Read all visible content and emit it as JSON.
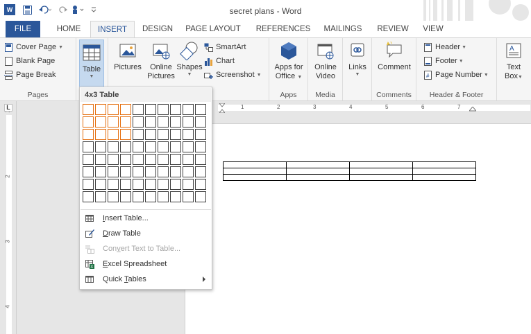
{
  "window": {
    "title": "secret plans - Word"
  },
  "tabs": [
    {
      "label": "FILE"
    },
    {
      "label": "HOME"
    },
    {
      "label": "INSERT"
    },
    {
      "label": "DESIGN"
    },
    {
      "label": "PAGE LAYOUT"
    },
    {
      "label": "REFERENCES"
    },
    {
      "label": "MAILINGS"
    },
    {
      "label": "REVIEW"
    },
    {
      "label": "VIEW"
    }
  ],
  "ribbon": {
    "pages": {
      "label": "Pages",
      "cover": "Cover Page",
      "blank": "Blank Page",
      "break": "Page Break"
    },
    "tables": {
      "table": "Table"
    },
    "illustrations": {
      "pictures": "Pictures",
      "online1": "Online",
      "online2": "Pictures",
      "shapes": "Shapes",
      "smartart": "SmartArt",
      "chart": "Chart",
      "screenshot": "Screenshot"
    },
    "apps": {
      "label": "Apps",
      "apps1": "Apps for",
      "apps2": "Office"
    },
    "media": {
      "label": "Media",
      "video1": "Online",
      "video2": "Video"
    },
    "links": {
      "links": "Links"
    },
    "comments": {
      "label": "Comments",
      "comment": "Comment"
    },
    "header_footer": {
      "label": "Header & Footer",
      "header": "Header",
      "footer": "Footer",
      "pagenum": "Page Number"
    },
    "text": {
      "text1": "Text",
      "text2": "Box"
    }
  },
  "dropdown": {
    "title": "4x3 Table",
    "grid": {
      "cols": 10,
      "rows": 8,
      "sel_cols": 4,
      "sel_rows": 3
    },
    "items": [
      {
        "pre": "",
        "key": "I",
        "post": "nsert Table...",
        "disabled": false
      },
      {
        "pre": "",
        "key": "D",
        "post": "raw Table",
        "disabled": false
      },
      {
        "pre": "Con",
        "key": "v",
        "post": "ert Text to Table...",
        "disabled": true
      },
      {
        "pre": "",
        "key": "E",
        "post": "xcel Spreadsheet",
        "disabled": false
      },
      {
        "pre": "Quick ",
        "key": "T",
        "post": "ables",
        "disabled": false
      }
    ]
  },
  "document": {
    "table": {
      "cols": 4,
      "rows": 3
    }
  },
  "ruler": {
    "vertical_marks": [
      "1",
      "2",
      "3",
      "4"
    ],
    "horizontal_marks": [
      "1",
      "2",
      "3",
      "4",
      "5",
      "6",
      "7"
    ]
  },
  "colors": {
    "accent": "#2b579a",
    "selection": "#e46c0a",
    "ribbon": "#f5f5f5"
  }
}
